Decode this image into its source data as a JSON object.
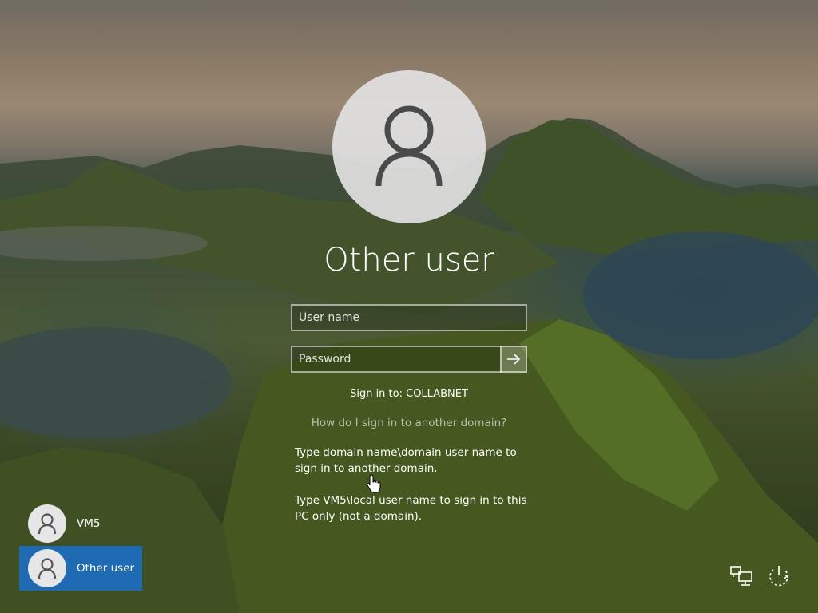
{
  "current_user": {
    "name": "Other user",
    "avatar_icon": "user-silhouette-icon"
  },
  "form": {
    "username_placeholder": "User name",
    "password_placeholder": "Password",
    "submit_icon": "arrow-right-icon",
    "sign_in_to": "Sign in to: COLLABNET",
    "help_link": "How do I sign in to another domain?",
    "tip_domain": "Type domain name\\domain user name to sign in to another domain.",
    "tip_local": "Type VM5\\local user name to sign in to this PC only (not a domain)."
  },
  "user_list": [
    {
      "name": "VM5",
      "selected": false
    },
    {
      "name": "Other user",
      "selected": true
    }
  ],
  "corner_icons": {
    "network": "network-icon",
    "power": "power-icon"
  },
  "colors": {
    "selected_user_bg": "#1e6bb3",
    "text": "#ffffff"
  }
}
